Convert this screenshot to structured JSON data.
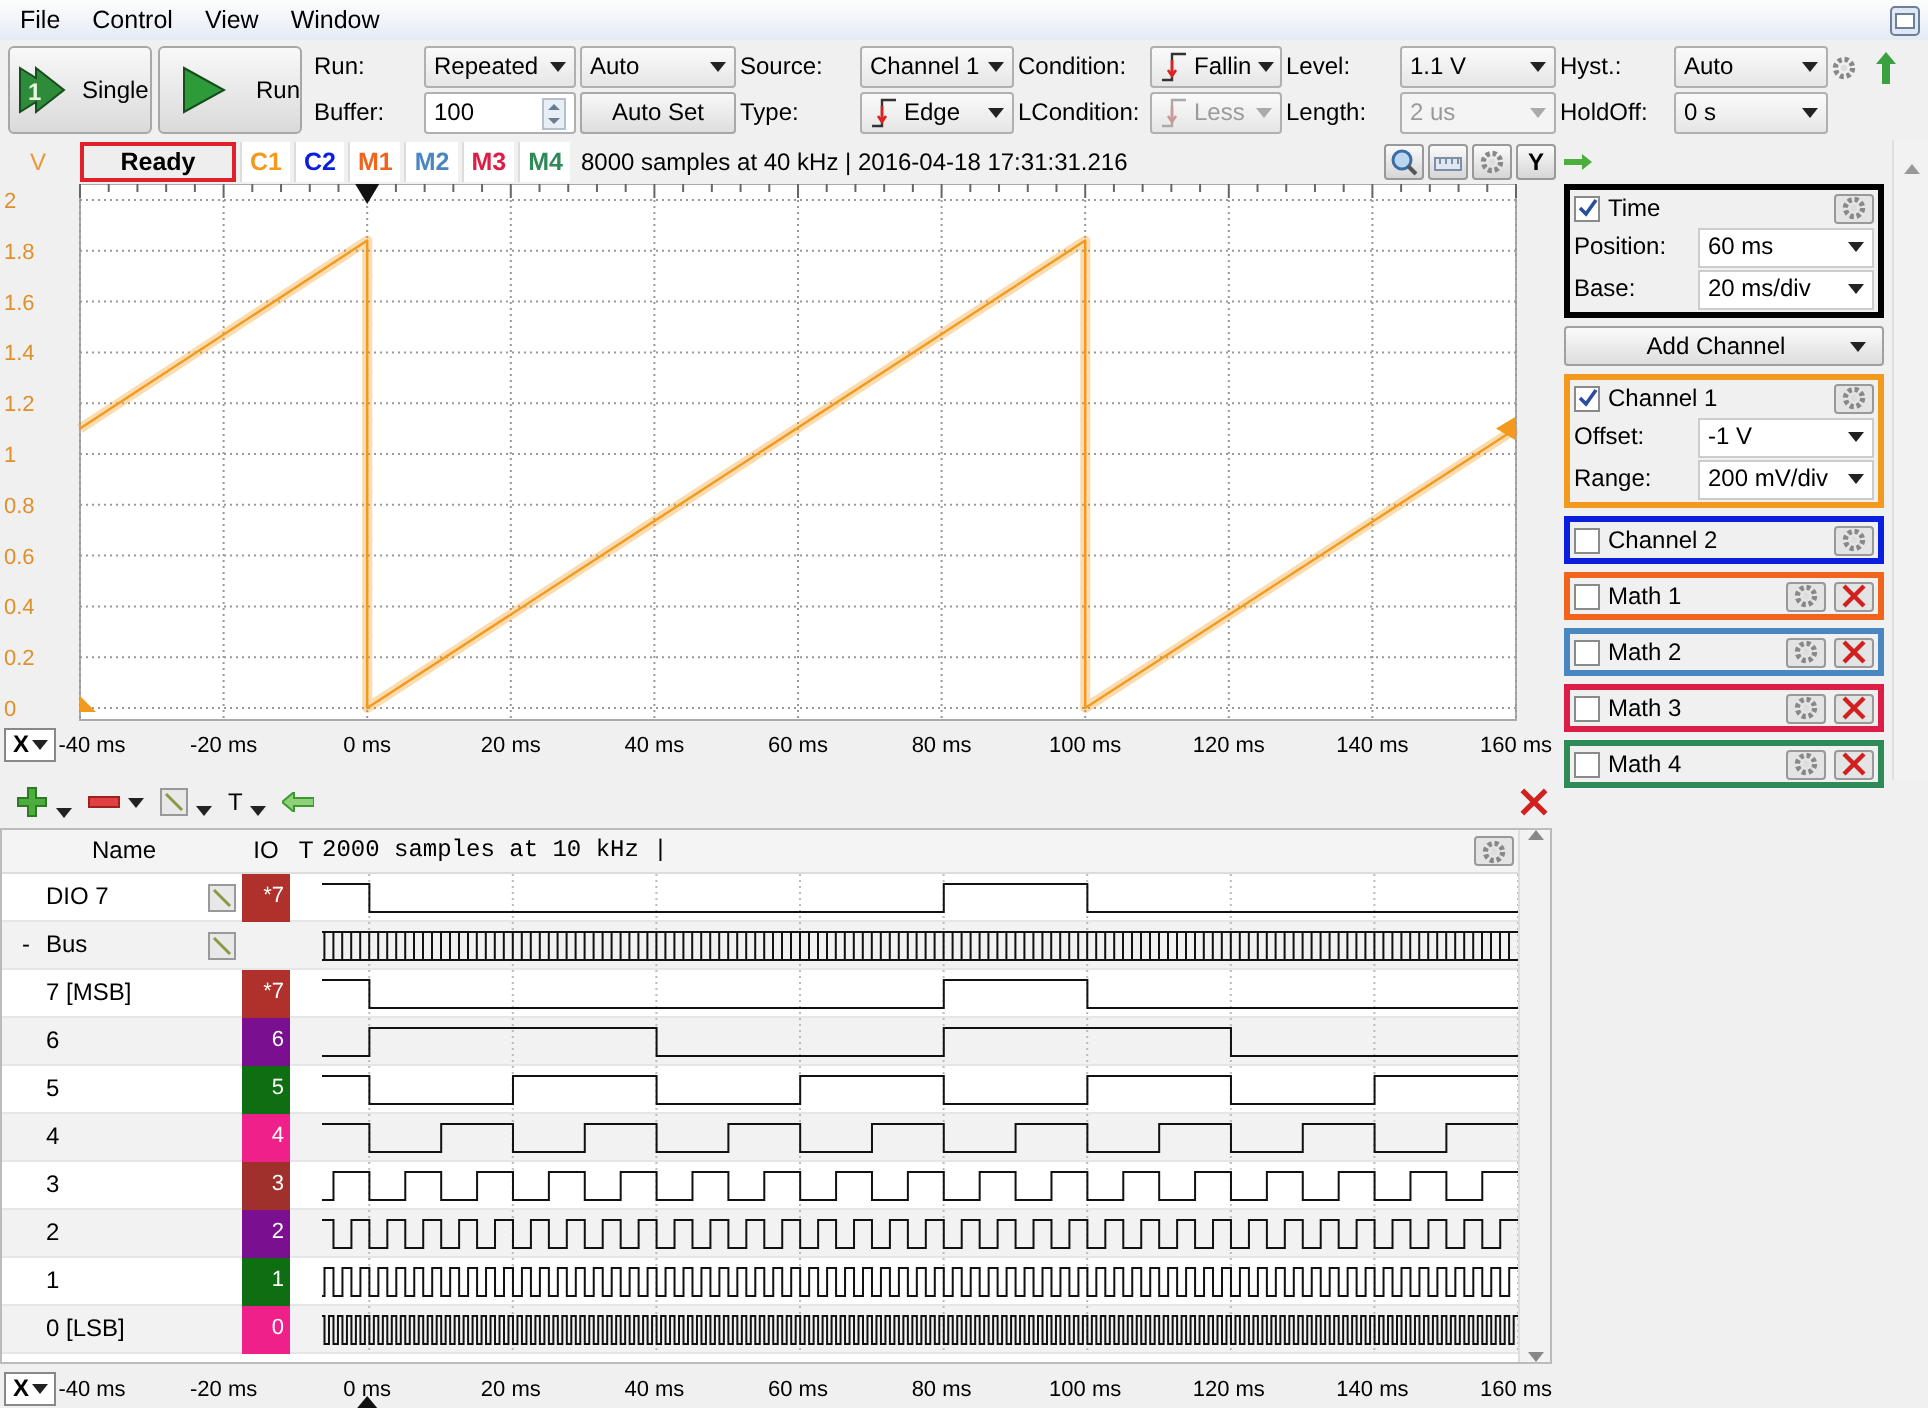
{
  "menu": [
    "File",
    "Control",
    "View",
    "Window"
  ],
  "toolbar": {
    "buttons": [
      {
        "label": "Single",
        "icon_label": "1"
      },
      {
        "label": "Run"
      }
    ],
    "rows": [
      [
        {
          "kind": "label",
          "text": "Run:"
        },
        {
          "kind": "select",
          "text": "Repeated"
        },
        {
          "kind": "select",
          "text": "Auto"
        },
        {
          "kind": "label",
          "text": "Source:"
        },
        {
          "kind": "select",
          "text": "Channel 1"
        },
        {
          "kind": "label",
          "text": "Condition:"
        },
        {
          "kind": "edge",
          "text": "Fallin",
          "disabled": false
        },
        {
          "kind": "label",
          "text": "Level:"
        },
        {
          "kind": "select",
          "text": "1.1 V",
          "disabled": false
        },
        {
          "kind": "label",
          "text": "Hyst.:"
        },
        {
          "kind": "select",
          "text": "Auto"
        },
        {
          "kind": "gear"
        },
        {
          "kind": "arrow"
        }
      ],
      [
        {
          "kind": "label",
          "text": "Buffer:"
        },
        {
          "kind": "spin",
          "text": "100"
        },
        {
          "kind": "button",
          "text": "Auto Set"
        },
        {
          "kind": "label",
          "text": "Type:"
        },
        {
          "kind": "edge",
          "text": "Edge",
          "disabled": false
        },
        {
          "kind": "label",
          "text": "LCondition:"
        },
        {
          "kind": "edge",
          "text": "Less",
          "disabled": true
        },
        {
          "kind": "label",
          "text": "Length:"
        },
        {
          "kind": "select",
          "text": "2 us",
          "disabled": true
        },
        {
          "kind": "label",
          "text": "HoldOff:"
        },
        {
          "kind": "select",
          "text": "0 s"
        }
      ]
    ]
  },
  "scope": {
    "status": "Ready",
    "channels": [
      {
        "label": "C1",
        "color": "#f39a1e"
      },
      {
        "label": "C2",
        "color": "#0a1ee0"
      },
      {
        "label": "M1",
        "color": "#f0641e"
      },
      {
        "label": "M2",
        "color": "#4a86c0"
      },
      {
        "label": "M3",
        "color": "#dc1e46"
      },
      {
        "label": "M4",
        "color": "#2e8b57"
      }
    ],
    "info": "8000 samples at 40 kHz | 2016-04-18 17:31:31.216",
    "y_button": "Y",
    "x_button": "X",
    "chart_data": {
      "type": "line",
      "ylabel": "V",
      "x": [
        -40,
        0,
        0,
        100,
        100,
        160
      ],
      "series": [
        {
          "color": "#f39a1e",
          "values": [
            1.1,
            1.84,
            0,
            1.84,
            0,
            1.1
          ]
        }
      ],
      "xlim": [
        -40,
        160
      ],
      "ylim": [
        0,
        2
      ],
      "grid": true,
      "xticks": [
        {
          "value": -40,
          "label": "-40 ms"
        },
        {
          "value": -20,
          "label": "-20 ms"
        },
        {
          "value": 0,
          "label": "0 ms"
        },
        {
          "value": 20,
          "label": "20 ms"
        },
        {
          "value": 40,
          "label": "40 ms"
        },
        {
          "value": 60,
          "label": "60 ms"
        },
        {
          "value": 80,
          "label": "80 ms"
        },
        {
          "value": 100,
          "label": "100 ms"
        },
        {
          "value": 120,
          "label": "120 ms"
        },
        {
          "value": 140,
          "label": "140 ms"
        },
        {
          "value": 160,
          "label": "160 ms"
        }
      ],
      "yticks": [
        {
          "value": 0,
          "label": "0"
        },
        {
          "value": 0.2,
          "label": "0.2"
        },
        {
          "value": 0.4,
          "label": "0.4"
        },
        {
          "value": 0.6,
          "label": "0.6"
        },
        {
          "value": 0.8,
          "label": "0.8"
        },
        {
          "value": 1,
          "label": "1"
        },
        {
          "value": 1.2,
          "label": "1.2"
        },
        {
          "value": 1.4,
          "label": "1.4"
        },
        {
          "value": 1.6,
          "label": "1.6"
        },
        {
          "value": 1.8,
          "label": "1.8"
        },
        {
          "value": 2,
          "label": "2"
        }
      ]
    }
  },
  "panel": {
    "items": [
      {
        "kind": "group",
        "title": "Time",
        "checked": true,
        "color": "#000000",
        "deletable": false,
        "fields": [
          {
            "label": "Position:",
            "value": "60 ms"
          },
          {
            "label": "Base:",
            "value": "20 ms/div"
          }
        ]
      },
      {
        "kind": "button",
        "title": "Add Channel"
      },
      {
        "kind": "group",
        "title": "Channel 1",
        "checked": true,
        "color": "#f39a1e",
        "deletable": false,
        "fields": [
          {
            "label": "Offset:",
            "value": "-1 V"
          },
          {
            "label": "Range:",
            "value": "200 mV/div"
          }
        ]
      },
      {
        "kind": "group",
        "title": "Channel 2",
        "checked": false,
        "color": "#0a1ee0",
        "deletable": false
      },
      {
        "kind": "group",
        "title": "Math 1",
        "checked": false,
        "color": "#f0641e",
        "deletable": true
      },
      {
        "kind": "group",
        "title": "Math 2",
        "checked": false,
        "color": "#4a86c0",
        "deletable": true
      },
      {
        "kind": "group",
        "title": "Math 3",
        "checked": false,
        "color": "#dc1e46",
        "deletable": true
      },
      {
        "kind": "group",
        "title": "Math 4",
        "checked": false,
        "color": "#2e8b57",
        "deletable": true
      }
    ]
  },
  "logic": {
    "toolbar_text": "T",
    "header": {
      "name": "Name",
      "io": "IO",
      "t": "T",
      "info": "2000 samples at 10 kHz |"
    },
    "rows": [
      {
        "name": "DIO 7",
        "editable": true,
        "io": "*7",
        "color": "#b0302c"
      },
      {
        "name": "Bus",
        "expander": "-",
        "editable": true,
        "children": [
          {
            "name": "7 [MSB]",
            "editable": false,
            "io": "*7",
            "color": "#b0302c"
          },
          {
            "name": "6",
            "editable": false,
            "io": "6",
            "color": "#7a1090"
          },
          {
            "name": "5",
            "editable": false,
            "io": "5",
            "color": "#0e6e12"
          },
          {
            "name": "4",
            "editable": false,
            "io": "4",
            "color": "#f0208a"
          },
          {
            "name": "3",
            "editable": false,
            "io": "3",
            "color": "#a0302c"
          },
          {
            "name": "2",
            "editable": false,
            "io": "2",
            "color": "#7a1090"
          },
          {
            "name": "1",
            "editable": false,
            "io": "1",
            "color": "#0e6e12"
          },
          {
            "name": "0 [LSB]",
            "editable": false,
            "io": "0",
            "color": "#f0208a"
          }
        ]
      }
    ],
    "x_button": "X",
    "axis_ticks": [
      "-40 ms",
      "-20 ms",
      "0 ms",
      "20 ms",
      "40 ms",
      "60 ms",
      "80 ms",
      "100 ms",
      "120 ms",
      "140 ms",
      "160 ms"
    ]
  }
}
